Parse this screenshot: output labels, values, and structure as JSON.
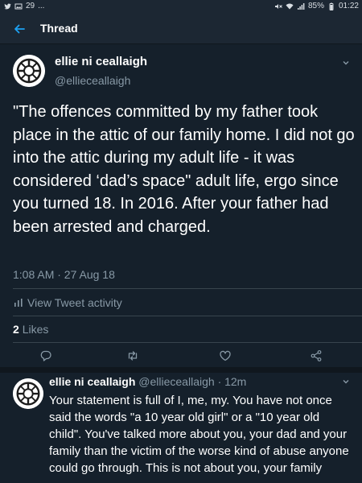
{
  "status_bar": {
    "left_text": "29",
    "dots": "...",
    "battery": "85%",
    "time": "01:22"
  },
  "header": {
    "title": "Thread"
  },
  "main_tweet": {
    "author_name": "ellie ni ceallaigh",
    "author_handle": "@ellieceallaigh",
    "text": "\"The offences committed by my father took place in the attic of our family home. I did not go into the attic during my adult life - it was considered ‘dad’s space\" adult life, ergo since you turned 18. In 2016. After your father had been arrested and charged.",
    "timestamp": "1:08 AM · 27 Aug 18",
    "view_activity_label": "View Tweet activity",
    "likes_count": "2",
    "likes_label": "Likes"
  },
  "actions": [
    "reply-icon",
    "retweet-icon",
    "like-icon",
    "share-icon"
  ],
  "reply_tweet": {
    "author_name": "ellie ni ceallaigh",
    "author_handle": "@ellieceallaigh",
    "time_ago": "· 12m",
    "text": "Your statement is full of I, me, my. You have not once said the words \"a 10 year old girl\" or a \"10 year old child\". You've talked more about you, your dad and your family than the victim  of the worse kind of abuse anyone could go through. This is not about you, your family"
  },
  "colors": {
    "background": "#15202b",
    "header": "#1c2733",
    "secondary_text": "#8899a6",
    "accent": "#1da1f2",
    "divider": "#38444d"
  }
}
